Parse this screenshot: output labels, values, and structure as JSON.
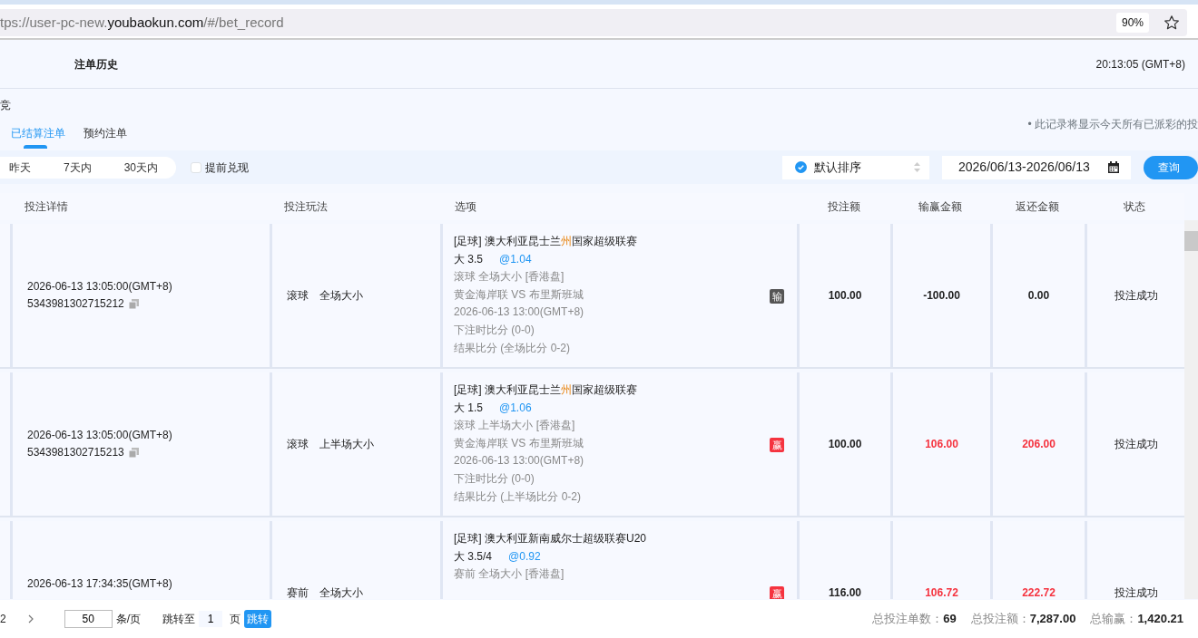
{
  "browser": {
    "url_prefix": "tps://user-pc-new.",
    "url_domain": "youbaokun.com",
    "url_path": "/#/bet_record",
    "zoom": "90%"
  },
  "header": {
    "title": "注单历史",
    "clock": "20:13:05 (GMT+8)"
  },
  "category": "竞",
  "tabs": [
    {
      "label": "已结算注单",
      "selected": true
    },
    {
      "label": "预约注单",
      "selected": false
    }
  ],
  "notice": "• 此记录将显示今天所有已派彩的投",
  "filters": {
    "ranges": [
      {
        "label": "昨天",
        "selected": false
      },
      {
        "label": "7天内",
        "selected": false
      },
      {
        "label": "30天内",
        "selected": false
      }
    ],
    "cash_out": {
      "label": "提前兑现",
      "checked": false
    },
    "sort": "默认排序",
    "date_range": "2026/06/13-2026/06/13",
    "query_button": "查询"
  },
  "table": {
    "columns": [
      "投注详情",
      "投注玩法",
      "选项",
      "投注额",
      "输赢金额",
      "返还金额",
      "状态"
    ],
    "rows": [
      {
        "time": "2026-06-13 13:05:00(GMT+8)",
        "bet_id": "5343981302715212",
        "play": [
          "滚球",
          "全场大小"
        ],
        "league": [
          {
            "text": "[足球] 澳大利亚昆士兰",
            "highlight": false
          },
          {
            "text": "州",
            "highlight": true
          },
          {
            "text": "国家超级联赛",
            "highlight": false
          }
        ],
        "pick": "大 3.5",
        "odds": "@1.04",
        "details": [
          "滚球 全场大小 [香港盘]",
          "黄金海岸联 VS 布里斯班城",
          "2026-06-13 13:00(GMT+8)",
          "下注时比分 (0-0)",
          "结果比分 (全场比分 0-2)"
        ],
        "kind": "lose",
        "badge": "输",
        "stake": "100.00",
        "win_loss": "-100.00",
        "returned": "0.00",
        "status": "投注成功"
      },
      {
        "time": "2026-06-13 13:05:00(GMT+8)",
        "bet_id": "5343981302715213",
        "play": [
          "滚球",
          "上半场大小"
        ],
        "league": [
          {
            "text": "[足球] 澳大利亚昆士兰",
            "highlight": false
          },
          {
            "text": "州",
            "highlight": true
          },
          {
            "text": "国家超级联赛",
            "highlight": false
          }
        ],
        "pick": "大 1.5",
        "odds": "@1.06",
        "details": [
          "滚球 上半场大小 [香港盘]",
          "黄金海岸联 VS 布里斯班城",
          "2026-06-13 13:00(GMT+8)",
          "下注时比分 (0-0)",
          "结果比分 (上半场比分 0-2)"
        ],
        "kind": "win",
        "badge": "赢",
        "stake": "100.00",
        "win_loss": "106.00",
        "returned": "206.00",
        "status": "投注成功"
      },
      {
        "time": "2026-06-13 17:34:35(GMT+8)",
        "play": [
          "赛前",
          "全场大小"
        ],
        "league": [
          {
            "text": "[足球] 澳大利亚新南威尔士超级联赛U20",
            "highlight": false
          }
        ],
        "pick": "大 3.5/4",
        "odds": "@0.92",
        "details": [
          "赛前 全场大小 [香港盘]"
        ],
        "kind": "win",
        "badge": "赢",
        "stake": "116.00",
        "win_loss": "106.72",
        "returned": "222.72",
        "status": "投注成功"
      }
    ]
  },
  "pagination": {
    "page": "2",
    "page_size": "50",
    "page_size_unit": "条/页",
    "jump_label": "跳转至",
    "jump_page": "1",
    "page_unit": "页",
    "jump_button": "跳转"
  },
  "totals": [
    {
      "label": "总投注单数：",
      "value": "69"
    },
    {
      "label": "总投注额：",
      "value": "7,287.00"
    },
    {
      "label": "总输赢：",
      "value": "1,420.21"
    }
  ]
}
